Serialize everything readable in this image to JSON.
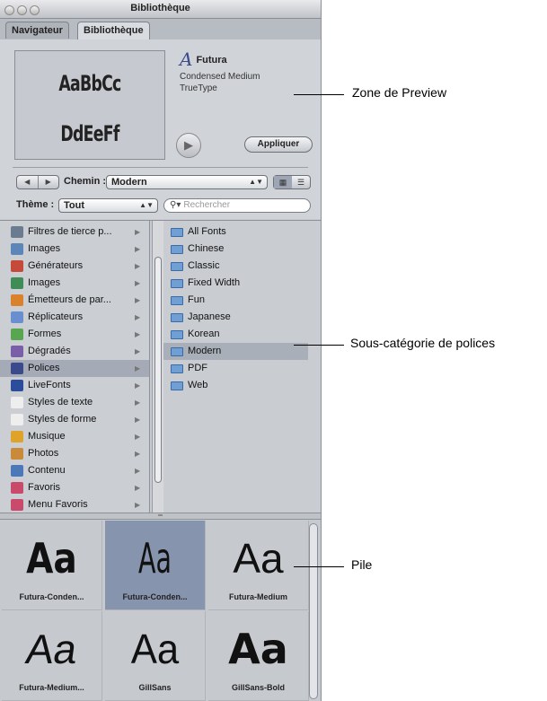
{
  "window": {
    "title": "Bibliothèque"
  },
  "tabs": [
    {
      "label": "Navigateur"
    },
    {
      "label": "Bibliothèque"
    }
  ],
  "preview": {
    "sample_line1": "AaBbCc",
    "sample_line2": "DdEeFf",
    "font_glyph": "A",
    "font_name": "Futura",
    "font_style": "Condensed Medium",
    "font_type": "TrueType",
    "apply_label": "Appliquer"
  },
  "path": {
    "label": "Chemin :",
    "value": "Modern"
  },
  "theme": {
    "label": "Thème :",
    "value": "Tout",
    "search_placeholder": "Rechercher"
  },
  "categories": [
    {
      "label": "Filtres de tierce p...",
      "icon": "filters-icon",
      "color": "#6c7c90"
    },
    {
      "label": "Images",
      "icon": "image-icon",
      "color": "#5d86b8"
    },
    {
      "label": "Générateurs",
      "icon": "generator-icon",
      "color": "#c64a3a"
    },
    {
      "label": "Images",
      "icon": "image-icon",
      "color": "#3f8c57"
    },
    {
      "label": "Émetteurs de par...",
      "icon": "emitter-icon",
      "color": "#d9822b"
    },
    {
      "label": "Réplicateurs",
      "icon": "replicator-icon",
      "color": "#6a8fd0"
    },
    {
      "label": "Formes",
      "icon": "shape-icon",
      "color": "#58a64f"
    },
    {
      "label": "Dégradés",
      "icon": "gradient-icon",
      "color": "#7b5ea8"
    },
    {
      "label": "Polices",
      "icon": "font-icon",
      "color": "#3a4a8a",
      "selected": true
    },
    {
      "label": "LiveFonts",
      "icon": "livefont-icon",
      "color": "#2b4d9c"
    },
    {
      "label": "Styles de texte",
      "icon": "text-style-icon",
      "color": "#eeeeee"
    },
    {
      "label": "Styles de forme",
      "icon": "shape-style-icon",
      "color": "#eeeeee"
    },
    {
      "label": "Musique",
      "icon": "music-icon",
      "color": "#e0a32a"
    },
    {
      "label": "Photos",
      "icon": "photo-icon",
      "color": "#c98a3a"
    },
    {
      "label": "Contenu",
      "icon": "content-icon",
      "color": "#4b78b9"
    },
    {
      "label": "Favoris",
      "icon": "favorites-icon",
      "color": "#c94a6a"
    },
    {
      "label": "Menu Favoris",
      "icon": "favorites-menu-icon",
      "color": "#c94a6a"
    }
  ],
  "subcategories": [
    {
      "label": "All Fonts"
    },
    {
      "label": "Chinese"
    },
    {
      "label": "Classic"
    },
    {
      "label": "Fixed Width"
    },
    {
      "label": "Fun"
    },
    {
      "label": "Japanese"
    },
    {
      "label": "Korean"
    },
    {
      "label": "Modern",
      "selected": true
    },
    {
      "label": "PDF"
    },
    {
      "label": "Web"
    }
  ],
  "fonts": [
    {
      "caption": "Futura-Conden...",
      "sample": "Aa"
    },
    {
      "caption": "Futura-Conden...",
      "sample": "Aa",
      "selected": true
    },
    {
      "caption": "Futura-Medium",
      "sample": "Aa"
    },
    {
      "caption": "Futura-Medium...",
      "sample": "Aa"
    },
    {
      "caption": "GillSans",
      "sample": "Aa"
    },
    {
      "caption": "GillSans-Bold",
      "sample": "Aa"
    }
  ],
  "callouts": {
    "preview": "Zone de Preview",
    "subcategory": "Sous-catégorie de polices",
    "stack": "Pile"
  }
}
